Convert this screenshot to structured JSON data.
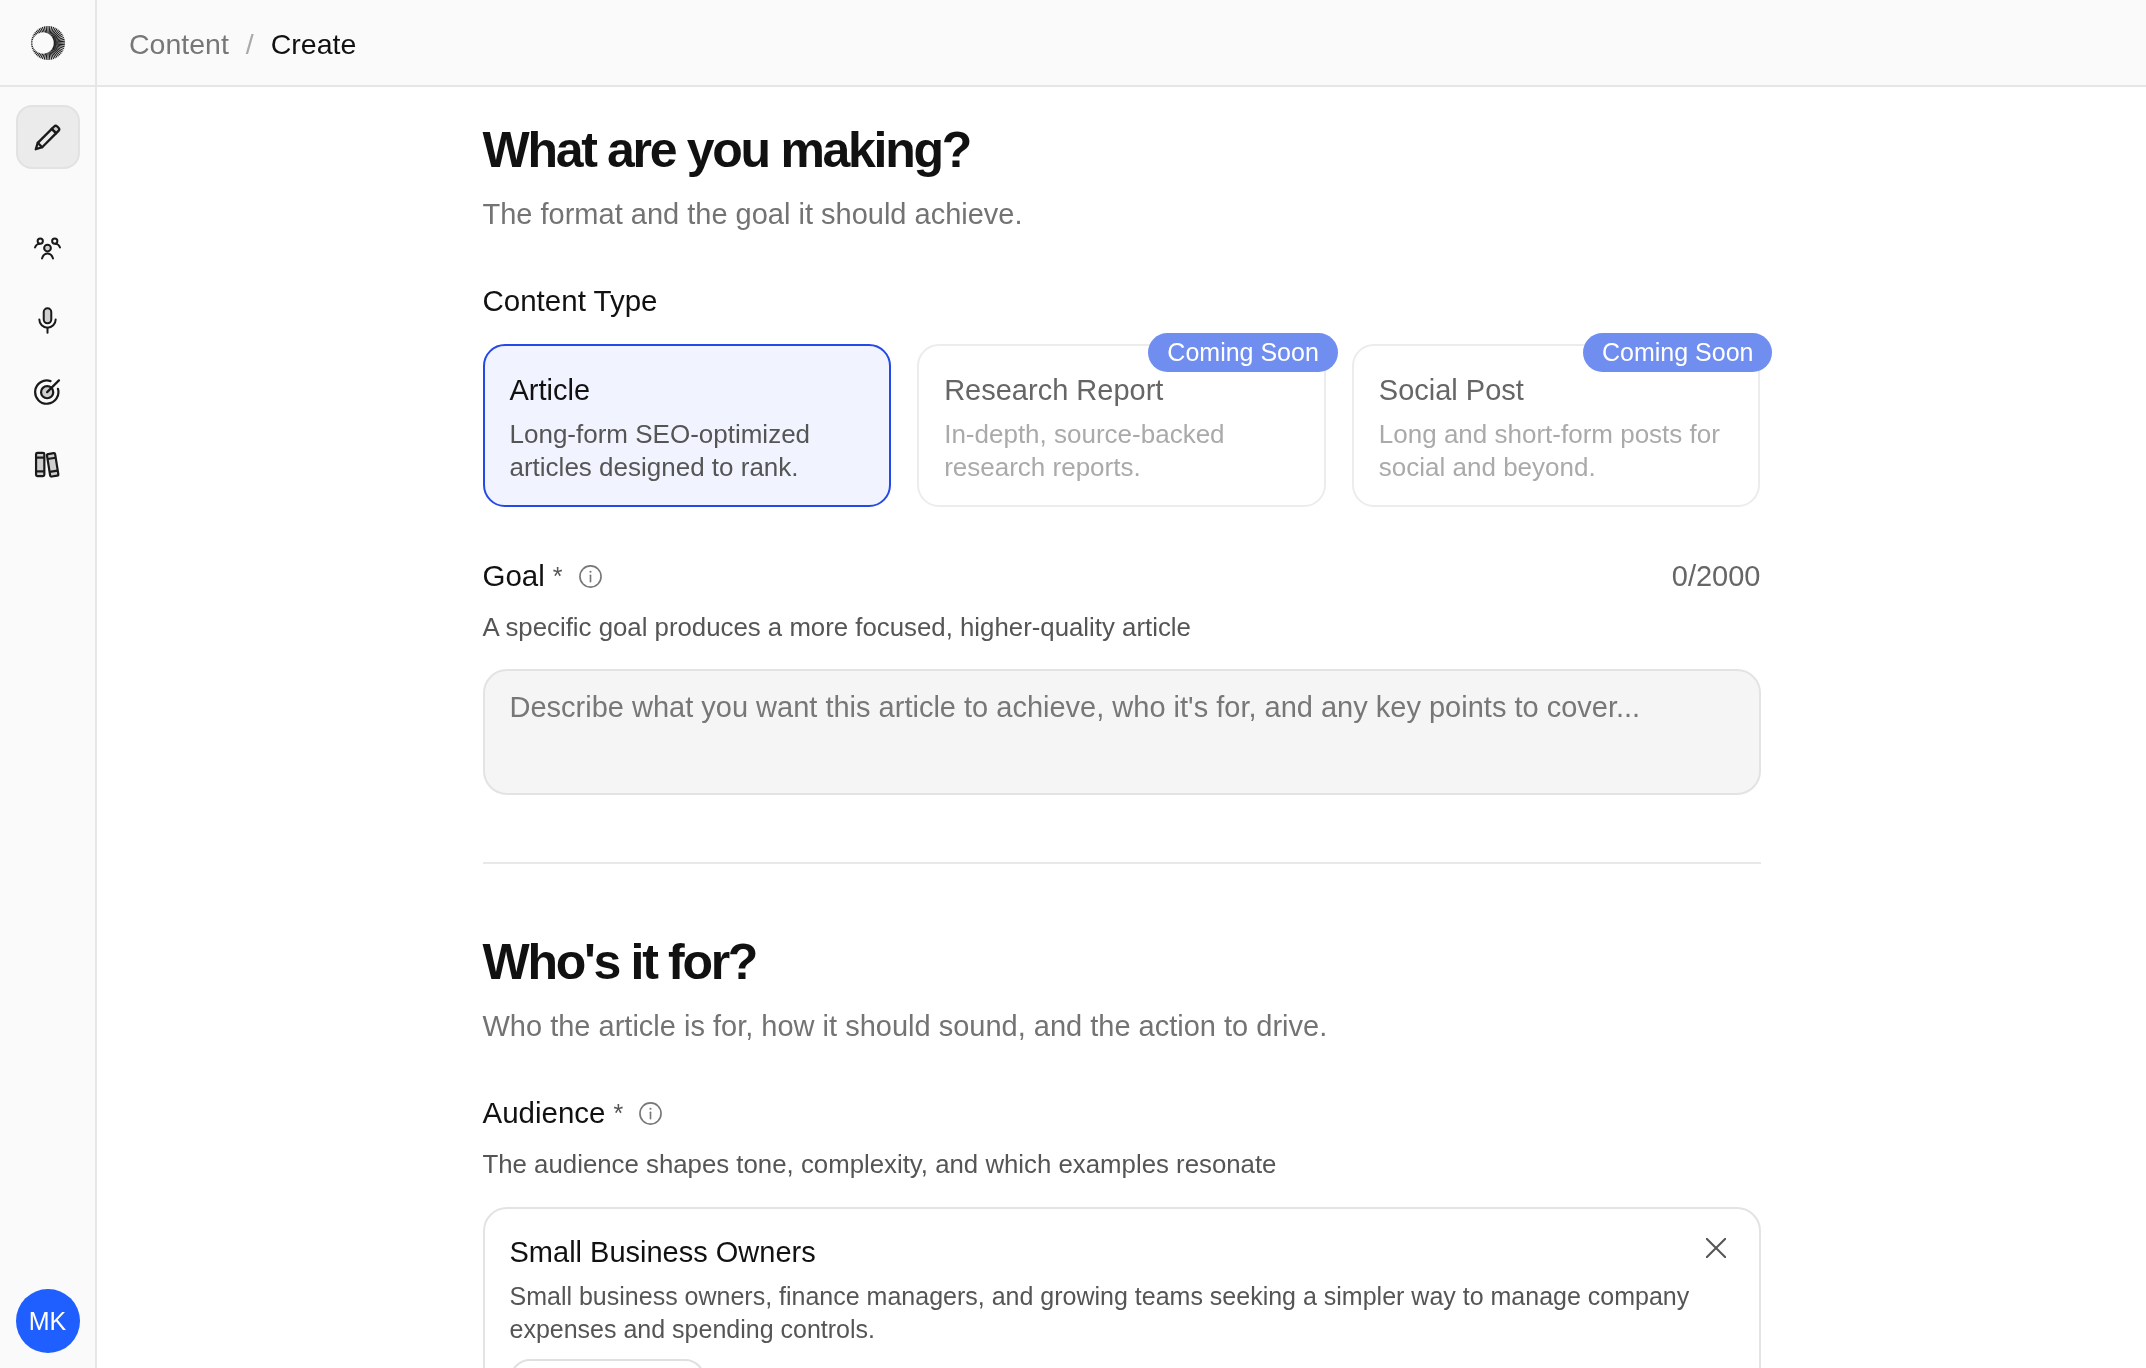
{
  "top_bar": {
    "breadcrumb": {
      "items": [
        {
          "label": "Content",
          "current": false
        },
        {
          "label": "Create",
          "current": true
        }
      ],
      "separator": "/"
    }
  },
  "sidebar": {
    "groups": [
      {
        "items": [
          {
            "selected": true
          }
        ]
      },
      {
        "items": [
          {
            "selected": false
          },
          {
            "selected": false
          },
          {
            "selected": false
          },
          {
            "selected": false
          }
        ]
      }
    ],
    "avatar": {
      "initials": "MK"
    }
  },
  "sections": [
    {
      "title": "What are you making?",
      "subtitle": "The format and the goal it should achieve.",
      "fields": [
        {
          "kind": "choice",
          "label": "Content Type",
          "options": [
            {
              "title": "Article",
              "description": "Long-form SEO-optimized articles designed to rank.",
              "selected": true,
              "disabled": false
            },
            {
              "title": "Research Report",
              "description": "In-depth, source-backed research reports.",
              "selected": false,
              "disabled": true,
              "badge": "Coming Soon"
            },
            {
              "title": "Social Post",
              "description": "Long and short-form posts for social and beyond.",
              "selected": false,
              "disabled": true,
              "badge": "Coming Soon"
            }
          ]
        },
        {
          "kind": "textarea",
          "label": "Goal",
          "required_mark": "*",
          "help": true,
          "counter": "0/2000",
          "hint": "A specific goal produces a more focused, higher-quality article",
          "placeholder": "Describe what you want this article to achieve, who it's for, and any key points to cover..."
        }
      ]
    },
    {
      "title": "Who's it for?",
      "subtitle": "Who the article is for, how it should sound, and the action to drive.",
      "fields": [
        {
          "kind": "selection",
          "label": "Audience",
          "required_mark": "*",
          "help": true,
          "hint": "The audience shapes tone, complexity, and which examples resonate",
          "selected_item": {
            "title": "Small Business Owners",
            "description": "Small business owners, finance managers, and growing teams seeking a simpler way to manage company expenses and spending controls."
          }
        }
      ]
    }
  ]
}
